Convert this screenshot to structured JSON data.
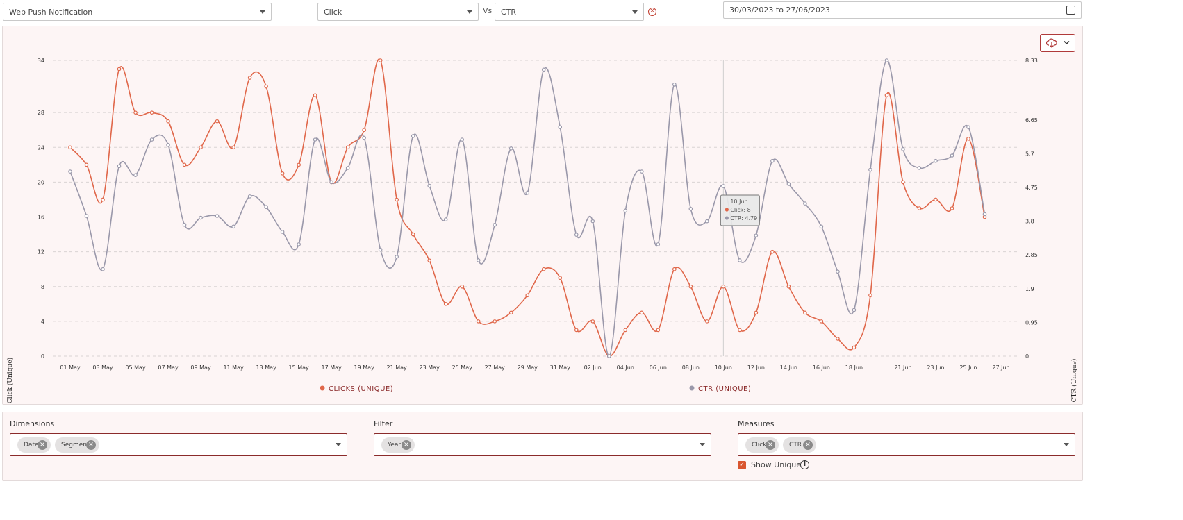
{
  "controls": {
    "source": "Web Push Notification",
    "measure": "Click",
    "vs_label": "Vs",
    "vs_measure": "CTR",
    "date_range": "30/03/2023 to 27/06/2023"
  },
  "colors": {
    "clicks": "#e0674a",
    "ctr": "#9a98aa",
    "accent": "#8b2b2b"
  },
  "chart_data": {
    "type": "line",
    "x": [
      "01 May",
      "02 May",
      "03 May",
      "04 May",
      "05 May",
      "06 May",
      "07 May",
      "08 May",
      "09 May",
      "10 May",
      "11 May",
      "12 May",
      "13 May",
      "14 May",
      "15 May",
      "16 May",
      "17 May",
      "18 May",
      "19 May",
      "20 May",
      "21 May",
      "22 May",
      "23 May",
      "24 May",
      "25 May",
      "26 May",
      "27 May",
      "28 May",
      "29 May",
      "30 May",
      "31 May",
      "01 Jun",
      "02 Jun",
      "03 Jun",
      "04 Jun",
      "05 Jun",
      "06 Jun",
      "07 Jun",
      "08 Jun",
      "09 Jun",
      "10 Jun",
      "11 Jun",
      "12 Jun",
      "13 Jun",
      "14 Jun",
      "15 Jun",
      "16 Jun",
      "17 Jun",
      "18 Jun",
      "19 Jun",
      "20 Jun",
      "21 Jun",
      "22 Jun",
      "23 Jun",
      "24 Jun",
      "25 Jun",
      "26 Jun",
      "27 Jun"
    ],
    "x_tick_labels": [
      "01 May",
      "03 May",
      "05 May",
      "07 May",
      "09 May",
      "11 May",
      "13 May",
      "15 May",
      "17 May",
      "19 May",
      "21 May",
      "23 May",
      "25 May",
      "27 May",
      "29 May",
      "31 May",
      "02 Jun",
      "04 Jun",
      "06 Jun",
      "08 Jun",
      "10 Jun",
      "12 Jun",
      "14 Jun",
      "16 Jun",
      "18 Jun",
      "21 Jun",
      "23 Jun",
      "25 Jun",
      "27 Jun"
    ],
    "series": [
      {
        "name": "CLICKS (UNIQUE)",
        "axis": "left",
        "values": [
          24,
          22,
          18,
          33,
          28,
          28,
          27,
          22,
          24,
          27,
          24,
          32,
          31,
          21,
          22,
          30,
          20,
          24,
          26,
          34,
          18,
          14,
          11,
          6,
          8,
          4,
          4,
          5,
          7,
          10,
          9,
          3,
          4,
          0,
          3,
          5,
          3,
          10,
          8,
          4,
          8,
          3,
          5,
          12,
          8,
          5,
          4,
          2,
          1,
          7,
          30,
          20,
          17,
          18,
          17,
          25,
          16
        ]
      },
      {
        "name": "CTR (UNIQUE)",
        "axis": "right",
        "values": [
          5.2,
          3.95,
          2.45,
          5.35,
          5.1,
          6.1,
          5.95,
          3.7,
          3.9,
          3.95,
          3.65,
          4.5,
          4.2,
          3.5,
          3.15,
          6.1,
          4.9,
          5.3,
          6.15,
          3.0,
          2.8,
          6.2,
          4.8,
          3.85,
          6.1,
          2.7,
          3.7,
          5.85,
          4.6,
          8.07,
          6.45,
          3.42,
          3.8,
          0,
          4.1,
          5.2,
          3.15,
          7.65,
          4.15,
          3.8,
          4.79,
          2.7,
          3.4,
          5.5,
          4.85,
          4.3,
          3.65,
          2.38,
          1.3,
          5.25,
          8.33,
          5.83,
          5.3,
          5.5,
          5.65,
          6.45,
          4.0
        ]
      }
    ],
    "ylabel": "Click (Unique)",
    "y2label": "CTR (Unique)",
    "y_ticks": [
      0,
      4,
      8,
      12,
      16,
      20,
      24,
      28,
      34
    ],
    "y2_ticks": [
      0,
      0.95,
      1.9,
      2.85,
      3.8,
      4.75,
      5.7,
      6.65,
      8.33
    ],
    "ylim": [
      0,
      34
    ],
    "y2lim": [
      0,
      8.33
    ],
    "grid": true,
    "legend": "bottom-center",
    "tooltip": {
      "index": 40,
      "title": "10 Jun",
      "click_text": "Click: 8",
      "ctr_text": "CTR: 4.79"
    }
  },
  "config": {
    "dimensions_label": "Dimensions",
    "dimensions_chips": [
      "Date",
      "Segment"
    ],
    "filter_label": "Filter",
    "filter_chips": [
      "Year"
    ],
    "measures_label": "Measures",
    "measures_chips": [
      "Click",
      "CTR"
    ],
    "show_unique_label": "Show Unique",
    "show_unique_checked": true
  }
}
